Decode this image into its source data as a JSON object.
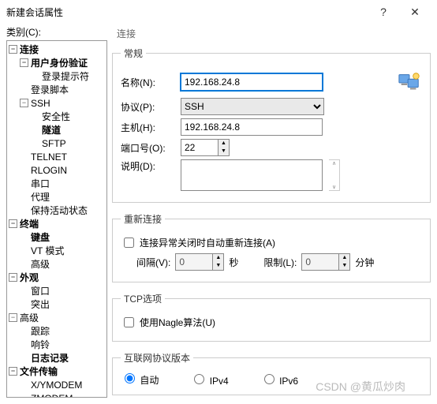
{
  "window": {
    "title": "新建会话属性",
    "help": "?",
    "close": "✕"
  },
  "left": {
    "categoryLabel": "类别(C):",
    "tree": {
      "connection": "连接",
      "auth": "用户身份验证",
      "loginPrompt": "登录提示符",
      "loginScript": "登录脚本",
      "ssh": "SSH",
      "security": "安全性",
      "tunnel": "隧道",
      "sftp": "SFTP",
      "telnet": "TELNET",
      "rlogin": "RLOGIN",
      "serial": "串口",
      "proxy": "代理",
      "keepalive": "保持活动状态",
      "terminal": "终端",
      "keyboard": "键盘",
      "vtmode": "VT 模式",
      "advanced": "高级",
      "appearance": "外观",
      "window": "窗口",
      "highlight": "突出",
      "advanced2": "高级",
      "trace": "跟踪",
      "bell": "响铃",
      "logging": "日志记录",
      "filetransfer": "文件传输",
      "xymodem": "X/YMODEM",
      "zmodem": "ZMODEM"
    }
  },
  "right": {
    "topLabel": "连接",
    "general": {
      "legend": "常规",
      "nameLabel": "名称(N):",
      "nameValue": "192.168.24.8",
      "protoLabel": "协议(P):",
      "protoValue": "SSH",
      "hostLabel": "主机(H):",
      "hostValue": "192.168.24.8",
      "portLabel": "端口号(O):",
      "portValue": "22",
      "descLabel": "说明(D):",
      "descValue": ""
    },
    "reconnect": {
      "legend": "重新连接",
      "autoLabel": "连接异常关闭时自动重新连接(A)",
      "intervalLabel": "间隔(V):",
      "intervalValue": "0",
      "secLabel": "秒",
      "limitLabel": "限制(L):",
      "limitValue": "0",
      "minLabel": "分钟"
    },
    "tcp": {
      "legend": "TCP选项",
      "nagleLabel": "使用Nagle算法(U)"
    },
    "ipver": {
      "legend": "互联网协议版本",
      "auto": "自动",
      "ipv4": "IPv4",
      "ipv6": "IPv6"
    }
  },
  "watermark": "CSDN @黄瓜炒肉"
}
